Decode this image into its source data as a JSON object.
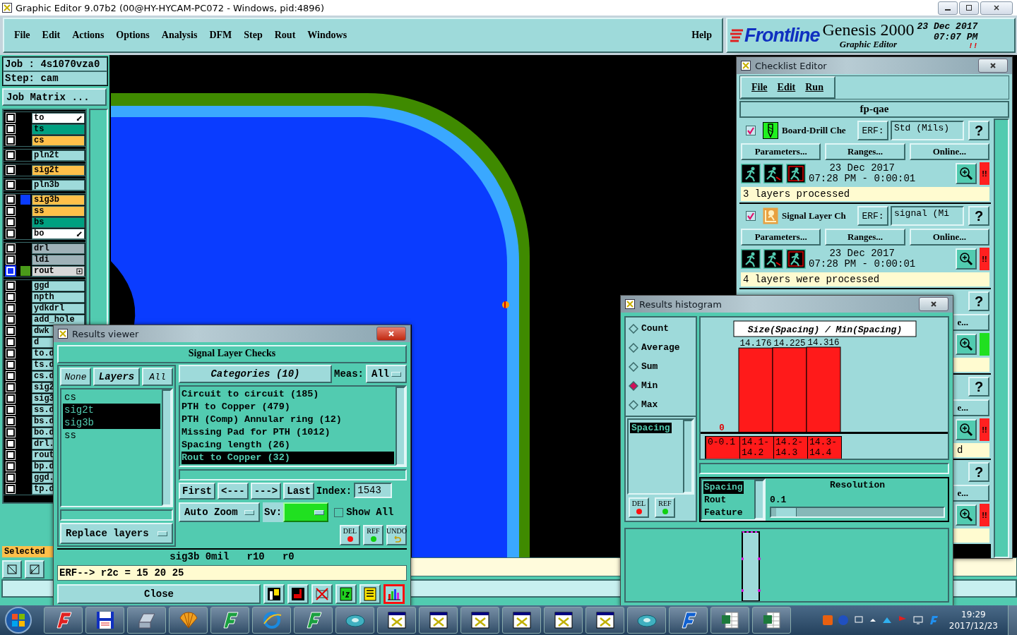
{
  "window": {
    "title": "Graphic Editor 9.07b2 (00@HY-HYCAM-PC072 - Windows, pid:4896)"
  },
  "menu": [
    "File",
    "Edit",
    "Actions",
    "Options",
    "Analysis",
    "DFM",
    "Step",
    "Rout",
    "Windows"
  ],
  "help": "Help",
  "brand": {
    "logo": "Frontline",
    "product": "Genesis 2000",
    "subtitle": "Graphic Editor",
    "date": "23 Dec 2017",
    "time": "07:07 PM",
    "alert": "!!"
  },
  "job": {
    "job": "Job : 4s1070vza0",
    "step": "Step: cam",
    "matrix_button": "Job Matrix ..."
  },
  "layer_groups": [
    {
      "layers": [
        {
          "name": "to",
          "color": "#ffffff",
          "kind": "arrow",
          "selected": false
        },
        {
          "name": "ts",
          "color": "#00a080",
          "kind": "plain",
          "selected": false
        },
        {
          "name": "cs",
          "color": "#ffc04a",
          "kind": "plain",
          "selected": false
        }
      ]
    },
    {
      "layers": [
        {
          "name": "pln2t",
          "color": "#9edada",
          "kind": "plain",
          "selected": false
        }
      ]
    },
    {
      "layers": [
        {
          "name": "sig2t",
          "color": "#ffc04a",
          "kind": "plain",
          "selected": false
        }
      ]
    },
    {
      "layers": [
        {
          "name": "pln3b",
          "color": "#9edada",
          "kind": "plain",
          "selected": false
        }
      ]
    },
    {
      "layers": [
        {
          "name": "sig3b",
          "color": "#ffc04a",
          "kind": "plain",
          "marker": {
            "color": "#0a3cff"
          },
          "selected": false
        },
        {
          "name": "ss",
          "color": "#ffc04a",
          "kind": "plain",
          "selected": false
        },
        {
          "name": "bs",
          "color": "#00a080",
          "kind": "plain",
          "selected": false
        },
        {
          "name": "bo",
          "color": "#ffffff",
          "kind": "arrow",
          "selected": false
        }
      ]
    },
    {
      "layers": [
        {
          "name": "drl",
          "color": "#9fb2b8",
          "kind": "plain",
          "selected": false
        },
        {
          "name": "ldi",
          "color": "#9fb2b8",
          "kind": "plain",
          "selected": false
        },
        {
          "name": "rout",
          "color": "#d8d8d8",
          "kind": "expand",
          "marker": {
            "color": "#4a9a1a"
          },
          "selected": true
        }
      ]
    },
    {
      "layers": [
        {
          "name": "ggd",
          "color": "#9edada",
          "kind": "plain",
          "selected": false
        },
        {
          "name": "npth",
          "color": "#9edada",
          "kind": "plain",
          "selected": false
        },
        {
          "name": "ydkdrl",
          "color": "#9edada",
          "kind": "plain",
          "selected": false
        },
        {
          "name": "add_hole",
          "color": "#9edada",
          "kind": "plain",
          "selected": false
        },
        {
          "name": "dwk",
          "color": "#9edada",
          "kind": "plain",
          "selected": false
        },
        {
          "name": "d",
          "color": "#9edada",
          "kind": "plain",
          "selected": false
        },
        {
          "name": "to.d",
          "color": "#9edada",
          "kind": "plain",
          "selected": false
        },
        {
          "name": "ts.d",
          "color": "#9edada",
          "kind": "plain",
          "selected": false
        },
        {
          "name": "cs.d",
          "color": "#9edada",
          "kind": "plain",
          "selected": false
        },
        {
          "name": "sig2",
          "color": "#9edada",
          "kind": "plain",
          "selected": false
        },
        {
          "name": "sig3",
          "color": "#9edada",
          "kind": "plain",
          "selected": false
        },
        {
          "name": "ss.d",
          "color": "#9edada",
          "kind": "plain",
          "selected": false
        },
        {
          "name": "bs.d",
          "color": "#9edada",
          "kind": "plain",
          "selected": false
        },
        {
          "name": "bo.d",
          "color": "#9edada",
          "kind": "plain",
          "selected": false
        },
        {
          "name": "drl.",
          "color": "#9edada",
          "kind": "plain",
          "selected": false
        },
        {
          "name": "rout",
          "color": "#9edada",
          "kind": "plain",
          "selected": false
        },
        {
          "name": "bp.d",
          "color": "#9edada",
          "kind": "plain",
          "selected": false
        },
        {
          "name": "ggd.",
          "color": "#9edada",
          "kind": "plain",
          "selected": false
        },
        {
          "name": "tp.d",
          "color": "#9edada",
          "kind": "plain",
          "selected": false
        }
      ]
    }
  ],
  "selected_label": "Selected",
  "results_viewer": {
    "title": "Results viewer",
    "header": "Signal Layer Checks",
    "none_button": "None",
    "layers_label": "Layers",
    "all_button": "All",
    "layers": [
      {
        "name": "cs",
        "selected": false
      },
      {
        "name": "sig2t",
        "selected": true
      },
      {
        "name": "sig3b",
        "selected": true
      },
      {
        "name": "ss",
        "selected": false
      }
    ],
    "replace": "Replace layers",
    "categories_button": "Categories (10)",
    "meas_label": "Meas:",
    "meas_value": "All",
    "categories": [
      {
        "label": "Circuit to circuit (185)",
        "selected": false
      },
      {
        "label": "PTH to Copper (479)",
        "selected": false
      },
      {
        "label": "PTH (Comp) Annular ring (12)",
        "selected": false
      },
      {
        "label": "Missing Pad for PTH (1012)",
        "selected": false
      },
      {
        "label": "Spacing length (26)",
        "selected": false
      },
      {
        "label": "Rout to Copper (32)",
        "selected": true
      }
    ],
    "nav": [
      "First",
      "<---",
      "--->",
      "Last"
    ],
    "index_label": "Index:",
    "index_value": "1543",
    "zoom": "Auto Zoom",
    "sv_label": "Sv:",
    "show_all": {
      "label": "Show All",
      "checked": false
    },
    "mark_buttons": [
      {
        "label": "DEL",
        "kind": "del"
      },
      {
        "label": "REF",
        "kind": "ref"
      },
      {
        "label": "UNDO",
        "kind": "undo"
      }
    ],
    "info": "sig3b 0mil   r10   r0",
    "erf": "ERF--> r2c = 15 20 25",
    "close": "Close",
    "tools": [
      {
        "kind": "flag",
        "selected": false
      },
      {
        "kind": "marker",
        "selected": false
      },
      {
        "kind": "erf",
        "selected": false
      },
      {
        "kind": "note",
        "selected": false
      },
      {
        "kind": "list",
        "selected": false
      },
      {
        "kind": "chart",
        "selected": true
      }
    ]
  },
  "checklist_editor": {
    "title": "Checklist Editor",
    "menu": [
      "File",
      "Edit",
      "Run"
    ],
    "name": "fp-qae",
    "items": [
      {
        "checked": true,
        "kind": "drill",
        "name": "Board-Drill Che",
        "erf_label": "ERF:",
        "erf_value": "Std (Mils)",
        "help": "?",
        "buttons": [
          "Parameters...",
          "Ranges...",
          "Online..."
        ],
        "date": "23 Dec 2017",
        "time": "07:28 PM - 0:00:01",
        "failed": true,
        "status_text": "!!",
        "message": "3 layers processed"
      },
      {
        "checked": true,
        "kind": "person",
        "name": "Signal Layer Ch",
        "erf_label": "ERF:",
        "erf_value": "signal (Mi",
        "help": "?",
        "buttons": [
          "Parameters...",
          "Ranges...",
          "Online..."
        ],
        "date": "23 Dec 2017",
        "time": "07:28 PM - 0:00:01",
        "failed": true,
        "status_text": "!!",
        "message": "4 layers were processed"
      },
      {
        "help": "?",
        "buttons": [
          "e..."
        ],
        "failed": false
      },
      {
        "help": "?",
        "buttons": [
          "e..."
        ],
        "failed": true,
        "status_text": "!!",
        "message": "d"
      },
      {
        "help": "?",
        "buttons": [
          "e..."
        ],
        "failed": true,
        "status_text": "!!"
      }
    ]
  },
  "histogram": {
    "title": "Results histogram",
    "modes": [
      {
        "label": "Count",
        "selected": false
      },
      {
        "label": "Average",
        "selected": false
      },
      {
        "label": "Sum",
        "selected": false
      },
      {
        "label": "Min",
        "selected": true
      },
      {
        "label": "Max",
        "selected": false
      }
    ],
    "list": [
      {
        "label": "Spacing",
        "selected": true
      }
    ],
    "mark_buttons": [
      {
        "label": "DEL",
        "kind": "del"
      },
      {
        "label": "REF",
        "kind": "ref"
      }
    ],
    "chart_data": {
      "type": "bar",
      "title": "Size(Spacing) / Min(Spacing)",
      "categories": [
        "0-0.1",
        "14.1-14.2",
        "14.2-14.3",
        "14.3-14.4"
      ],
      "values": [
        0,
        14.176,
        14.225,
        14.316
      ],
      "data_labels": true
    },
    "fields": [
      {
        "label": "Spacing",
        "selected": true
      },
      {
        "label": "Rout",
        "selected": false
      },
      {
        "label": "Feature",
        "selected": false
      }
    ],
    "resolution_label": "Resolution",
    "resolution_value": "0.1",
    "resolution": {
      "level": 0.03
    }
  },
  "taskbar": {
    "apps": [
      {
        "kind": "red-logo"
      },
      {
        "kind": "floppy"
      },
      {
        "kind": "scanner"
      },
      {
        "kind": "shell"
      },
      {
        "kind": "green-logo"
      },
      {
        "kind": "browser"
      },
      {
        "kind": "green-logo"
      },
      {
        "kind": "disc"
      },
      {
        "kind": "window"
      },
      {
        "kind": "window"
      },
      {
        "kind": "window"
      },
      {
        "kind": "window"
      },
      {
        "kind": "window"
      },
      {
        "kind": "window"
      },
      {
        "kind": "disc"
      },
      {
        "kind": "blue-logo"
      },
      {
        "kind": "spreadsheet"
      },
      {
        "kind": "spreadsheet"
      }
    ],
    "time": "19:29",
    "date": "2017/12/23"
  }
}
